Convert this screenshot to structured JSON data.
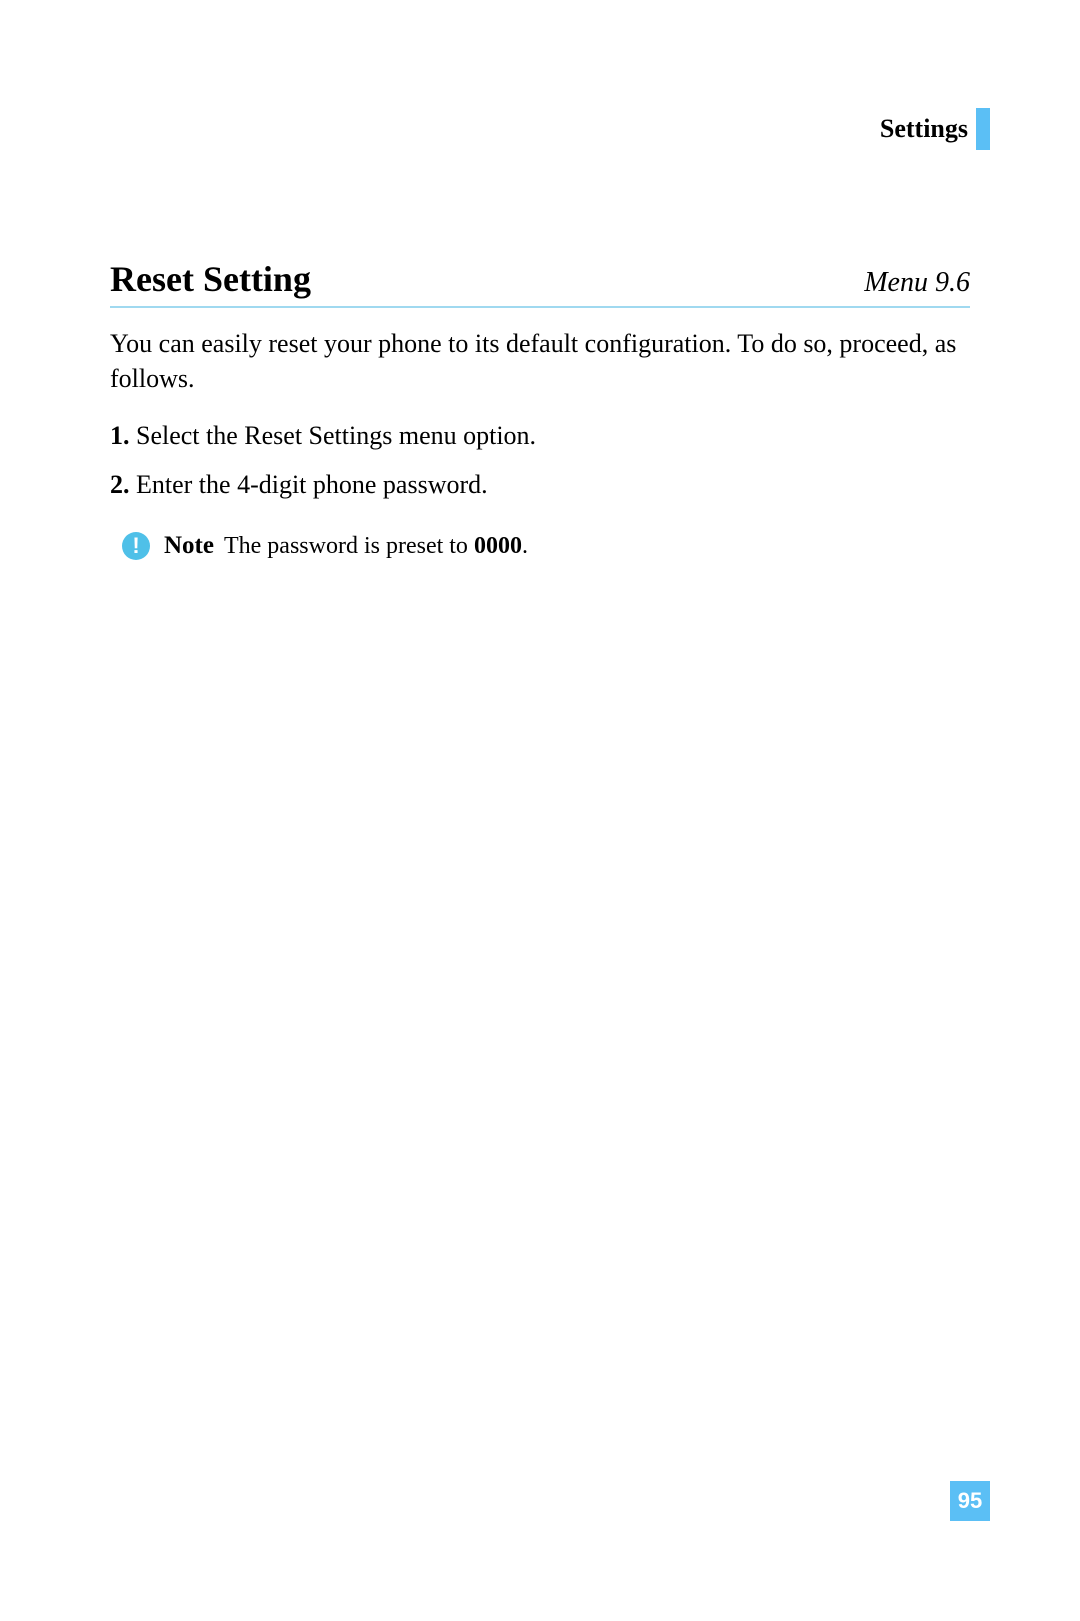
{
  "header": {
    "label": "Settings"
  },
  "section": {
    "title": "Reset Setting",
    "menu": "Menu 9.6",
    "intro": "You can easily reset your phone to its default configuration. To do so, proceed, as follows.",
    "steps": [
      {
        "num": "1.",
        "text": "Select the Reset Settings menu option."
      },
      {
        "num": "2.",
        "text": "Enter the 4-digit phone password."
      }
    ],
    "note": {
      "label": "Note",
      "text_prefix": "The password is preset to ",
      "bold": "0000",
      "text_suffix": "."
    }
  },
  "page_number": "95"
}
